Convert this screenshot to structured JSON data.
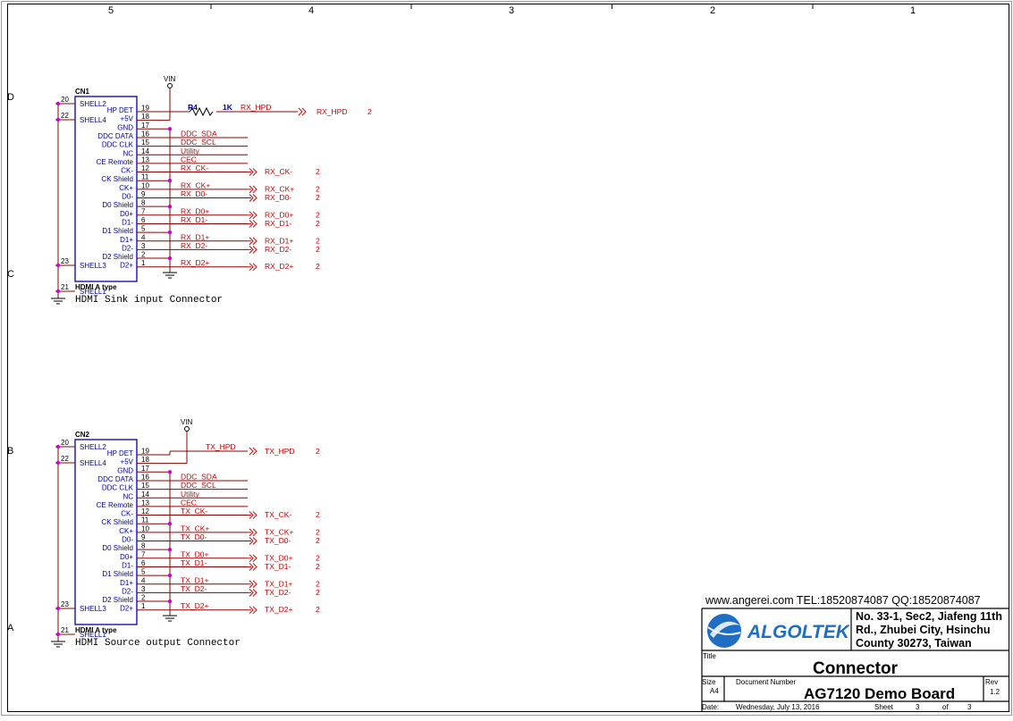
{
  "frame": {
    "columns": [
      "5",
      "4",
      "3",
      "2",
      "1"
    ],
    "rows": [
      "D",
      "C",
      "B",
      "A"
    ]
  },
  "connectors": [
    {
      "refdes": "CN1",
      "type": "HDMI A type",
      "caption": "HDMI Sink input Connector",
      "power": "VIN",
      "resistor": {
        "ref": "R4",
        "value": "1K",
        "net": "RX_HPD"
      },
      "shell_pins": [
        {
          "num": "20",
          "name": "SHELL2"
        },
        {
          "num": "22",
          "name": "SHELL4"
        },
        {
          "num": "23",
          "name": "SHELL3"
        },
        {
          "num": "21",
          "name": "SHELL1"
        }
      ],
      "pins": [
        {
          "num": "19",
          "name": "HP DET"
        },
        {
          "num": "18",
          "name": "+5V"
        },
        {
          "num": "17",
          "name": "GND"
        },
        {
          "num": "16",
          "name": "DDC DATA",
          "net": "DDC_SDA"
        },
        {
          "num": "15",
          "name": "DDC CLK",
          "net": "DDC_SCL"
        },
        {
          "num": "14",
          "name": "NC",
          "net": "Utility"
        },
        {
          "num": "13",
          "name": "CE Remote",
          "net": "CEC"
        },
        {
          "num": "12",
          "name": "CK-",
          "net": "RX_CK-",
          "port": "RX_CK-",
          "sheet": "2"
        },
        {
          "num": "11",
          "name": "CK Shield"
        },
        {
          "num": "10",
          "name": "CK+",
          "net": "RX_CK+",
          "port": "RX_CK+",
          "sheet": "2"
        },
        {
          "num": "9",
          "name": "D0-",
          "net": "RX_D0-",
          "port": "RX_D0-",
          "sheet": "2"
        },
        {
          "num": "8",
          "name": "D0 Shield"
        },
        {
          "num": "7",
          "name": "D0+",
          "net": "RX_D0+",
          "port": "RX_D0+",
          "sheet": "2"
        },
        {
          "num": "6",
          "name": "D1-",
          "net": "RX_D1-",
          "port": "RX_D1-",
          "sheet": "2"
        },
        {
          "num": "5",
          "name": "D1 Shield"
        },
        {
          "num": "4",
          "name": "D1+",
          "net": "RX_D1+",
          "port": "RX_D1+",
          "sheet": "2"
        },
        {
          "num": "3",
          "name": "D2-",
          "net": "RX_D2-",
          "port": "RX_D2-",
          "sheet": "2"
        },
        {
          "num": "2",
          "name": "D2 Shield"
        },
        {
          "num": "1",
          "name": "D2+",
          "net": "RX_D2+",
          "port": "RX_D2+",
          "sheet": "2"
        }
      ],
      "hpd_port": {
        "label": "RX_HPD",
        "sheet": "2"
      }
    },
    {
      "refdes": "CN2",
      "type": "HDMI A type",
      "caption": "HDMI Source  output Connector",
      "power": "VIN",
      "hpd_net": "TX_HPD",
      "shell_pins": [
        {
          "num": "20",
          "name": "SHELL2"
        },
        {
          "num": "22",
          "name": "SHELL4"
        },
        {
          "num": "23",
          "name": "SHELL3"
        },
        {
          "num": "21",
          "name": "SHELL1"
        }
      ],
      "pins": [
        {
          "num": "19",
          "name": "HP DET"
        },
        {
          "num": "18",
          "name": "+5V"
        },
        {
          "num": "17",
          "name": "GND"
        },
        {
          "num": "16",
          "name": "DDC DATA",
          "net": "DDC_SDA"
        },
        {
          "num": "15",
          "name": "DDC CLK",
          "net": "DDC_SCL"
        },
        {
          "num": "14",
          "name": "NC",
          "net": "Utility"
        },
        {
          "num": "13",
          "name": "CE Remote",
          "net": "CEC"
        },
        {
          "num": "12",
          "name": "CK-",
          "net": "TX_CK-",
          "port": "TX_CK-",
          "sheet": "2"
        },
        {
          "num": "11",
          "name": "CK Shield"
        },
        {
          "num": "10",
          "name": "CK+",
          "net": "TX_CK+",
          "port": "TX_CK+",
          "sheet": "2"
        },
        {
          "num": "9",
          "name": "D0-",
          "net": "TX_D0-",
          "port": "TX_D0-",
          "sheet": "2"
        },
        {
          "num": "8",
          "name": "D0 Shield"
        },
        {
          "num": "7",
          "name": "D0+",
          "net": "TX_D0+",
          "port": "TX_D0+",
          "sheet": "2"
        },
        {
          "num": "6",
          "name": "D1-",
          "net": "TX_D1-",
          "port": "TX_D1-",
          "sheet": "2"
        },
        {
          "num": "5",
          "name": "D1 Shield"
        },
        {
          "num": "4",
          "name": "D1+",
          "net": "TX_D1+",
          "port": "TX_D1+",
          "sheet": "2"
        },
        {
          "num": "3",
          "name": "D2-",
          "net": "TX_D2-",
          "port": "TX_D2-",
          "sheet": "2"
        },
        {
          "num": "2",
          "name": "D2 Shield"
        },
        {
          "num": "1",
          "name": "D2+",
          "net": "TX_D2+",
          "port": "TX_D2+",
          "sheet": "2"
        }
      ],
      "hpd_port": {
        "label": "TX_HPD",
        "sheet": "2"
      }
    }
  ],
  "title_block": {
    "watermark": "www.angerei.com  TEL:18520874087  QQ:18520874087",
    "company": "ALGOLTEK",
    "address": [
      "No. 33-1, Sec2, Jiafeng 11th",
      "Rd., Zhubei City, Hsinchu",
      "County 30273, Taiwan"
    ],
    "title_label": "Title",
    "title": "Connector",
    "size_label": "Size",
    "size": "A4",
    "docnum_label": "Document Number",
    "docnum": "AG7120 Demo Board",
    "rev_label": "Rev",
    "rev": "1.2",
    "date_label": "Date:",
    "date": "Wednesday, July 13, 2016",
    "sheet_label": "Sheet",
    "sheet": "3",
    "of_label": "of",
    "sheet_total": "3"
  },
  "colors": {
    "component": "#0000a8",
    "net": "#cc0000",
    "junction": "#d400d4",
    "wire": "#8b0000",
    "logo_blue": "#1e6fc4",
    "text": "#000000"
  }
}
